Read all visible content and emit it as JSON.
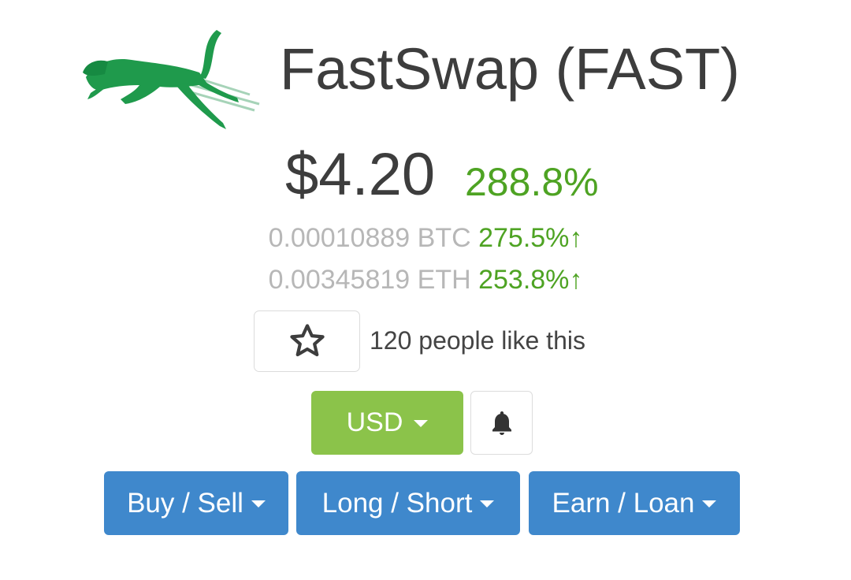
{
  "coin": {
    "title": "FastSwap (FAST)",
    "logo_icon": "green-cheetah-logo",
    "usd_price": "$4.20",
    "usd_change": "288.8%",
    "btc_price": "0.00010889 BTC",
    "btc_change": "275.5%",
    "eth_price": "0.00345819 ETH",
    "eth_change": "253.8%",
    "up_arrow_glyph": "↑"
  },
  "likes": {
    "icon": "star-icon",
    "text": "120 people like this"
  },
  "currency": {
    "selected": "USD",
    "button_color": "#8bc34a"
  },
  "alerts": {
    "icon": "bell-icon"
  },
  "actions": {
    "buy_sell": "Buy / Sell",
    "long_short": "Long / Short",
    "earn_loan": "Earn / Loan",
    "button_color": "#3f88cc"
  },
  "colors": {
    "positive": "#4ea323",
    "muted": "#b7b7b7",
    "text": "#3d3d3d"
  }
}
